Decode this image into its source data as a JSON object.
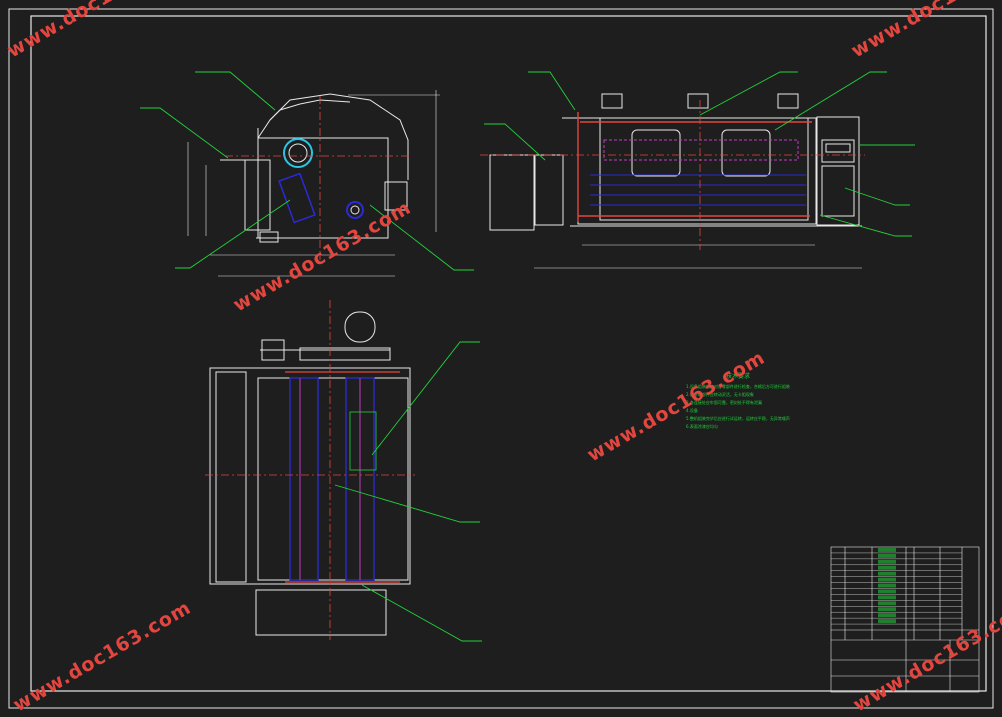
{
  "watermark": {
    "text": "www.doc163.com",
    "color": "#e2463f"
  },
  "colors": {
    "background": "#1e1e1e",
    "line": "#e8e8e8",
    "center_line": "#e2463f",
    "hidden": "#2b2bd6",
    "leader": "#22d13c",
    "cyan": "#29c7e6",
    "magenta": "#c23ac2",
    "yellow": "#e5e52d"
  },
  "notes": {
    "title": "技术要求",
    "lines": [
      "1.设备组装前应对各零部件进行检查，合格后方可进行组装",
      "2.各转动部件应转动灵活，无卡阻现象",
      "3.各连接处应牢固可靠，密封处不得有泄漏",
      "4.设备",
      "5.整机组装完毕后应进行试运转，运转应平稳，无异常噪声",
      "6.表面涂漆应均匀"
    ]
  },
  "title_block": {
    "parts_rows": 14,
    "footer_labels": [
      "序号",
      "代号",
      "名称",
      "数量",
      "材料",
      "备注"
    ]
  }
}
